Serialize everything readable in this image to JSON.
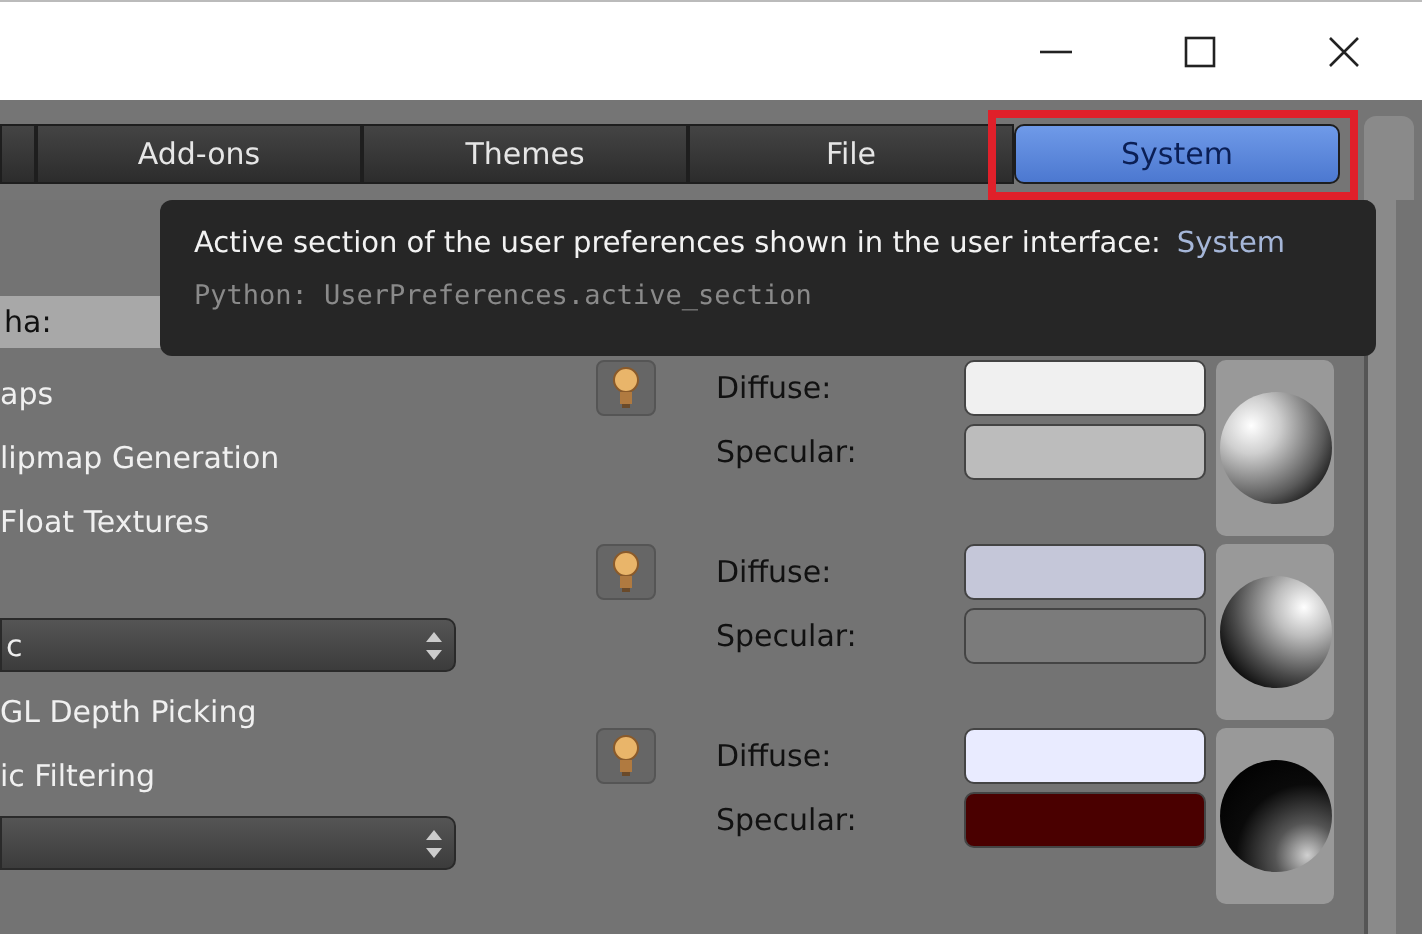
{
  "tabs": [
    {
      "selected": false
    },
    {
      "label": "Add-ons",
      "selected": false
    },
    {
      "label": "Themes",
      "selected": false
    },
    {
      "label": "File",
      "selected": false
    },
    {
      "label": "System",
      "selected": true
    }
  ],
  "tooltip": {
    "description": "Active section of the user preferences shown in the user interface:",
    "value": "System",
    "python": "Python: UserPreferences.active_section"
  },
  "left_items": [
    {
      "kind": "field",
      "text": "ha:"
    },
    {
      "kind": "label",
      "text": "aps"
    },
    {
      "kind": "label",
      "text": "lipmap Generation"
    },
    {
      "kind": "label",
      "text": "Float Textures"
    },
    {
      "kind": "spacer"
    },
    {
      "kind": "dropdown",
      "text": "c"
    },
    {
      "kind": "label",
      "text": "GL Depth Picking"
    },
    {
      "kind": "label",
      "text": "ic Filtering"
    },
    {
      "kind": "dropdown"
    }
  ],
  "lights": [
    {
      "kind": "topleft",
      "diffuse": {
        "label": "Diffuse:",
        "color": "#f0f0f0"
      },
      "specular": {
        "label": "Specular:",
        "color": "#bcbcbc"
      }
    },
    {
      "kind": "topright",
      "diffuse": {
        "label": "Diffuse:",
        "color": "#c5c7d9"
      },
      "specular": {
        "label": "Specular:",
        "color": "#7b7b7b"
      }
    },
    {
      "kind": "bottomright",
      "diffuse": {
        "label": "Diffuse:",
        "color": "#e9ebff"
      },
      "specular": {
        "label": "Specular:",
        "color": "#4a0000"
      }
    }
  ]
}
